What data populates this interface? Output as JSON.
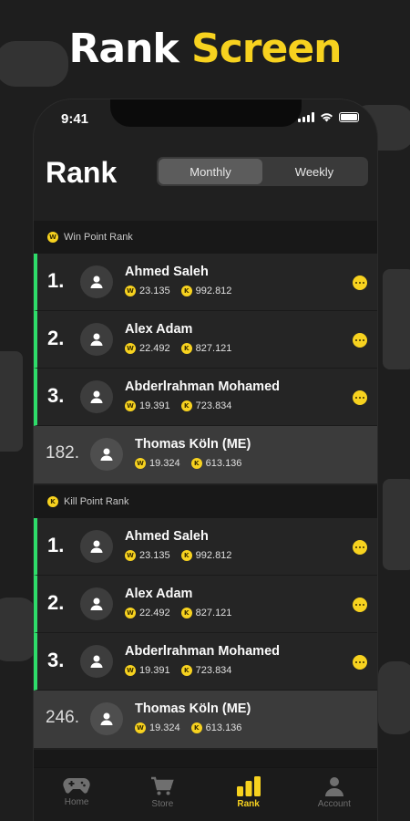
{
  "banner": {
    "word1": "Rank",
    "word2": "Screen"
  },
  "status_bar": {
    "time": "9:41"
  },
  "header": {
    "title": "Rank"
  },
  "segment": {
    "options": [
      "Monthly",
      "Weekly"
    ],
    "selected": "Monthly"
  },
  "sections": [
    {
      "title": "Win Point Rank",
      "badge": "W",
      "rows": [
        {
          "rank": "1.",
          "name": "Ahmed Saleh",
          "win": "23.135",
          "kill": "992.812"
        },
        {
          "rank": "2.",
          "name": "Alex Adam",
          "win": "22.492",
          "kill": "827.121"
        },
        {
          "rank": "3.",
          "name": "Abderlrahman Mohamed",
          "win": "19.391",
          "kill": "723.834"
        }
      ],
      "me": {
        "rank": "182.",
        "name": "Thomas Köln (ME)",
        "win": "19.324",
        "kill": "613.136"
      }
    },
    {
      "title": "Kill Point Rank",
      "badge": "K",
      "rows": [
        {
          "rank": "1.",
          "name": "Ahmed Saleh",
          "win": "23.135",
          "kill": "992.812"
        },
        {
          "rank": "2.",
          "name": "Alex Adam",
          "win": "22.492",
          "kill": "827.121"
        },
        {
          "rank": "3.",
          "name": "Abderlrahman Mohamed",
          "win": "19.391",
          "kill": "723.834"
        }
      ],
      "me": {
        "rank": "246.",
        "name": "Thomas Köln (ME)",
        "win": "19.324",
        "kill": "613.136"
      }
    }
  ],
  "coins": {
    "win": "W",
    "kill": "K"
  },
  "tabs": [
    {
      "label": "Home",
      "icon": "gamepad-icon"
    },
    {
      "label": "Store",
      "icon": "cart-icon"
    },
    {
      "label": "Rank",
      "icon": "bar-chart-icon"
    },
    {
      "label": "Account",
      "icon": "person-icon"
    }
  ],
  "active_tab": "Rank",
  "colors": {
    "accent": "#f7d21f",
    "highlight": "#2edc6a",
    "background": "#1e1e1e"
  }
}
